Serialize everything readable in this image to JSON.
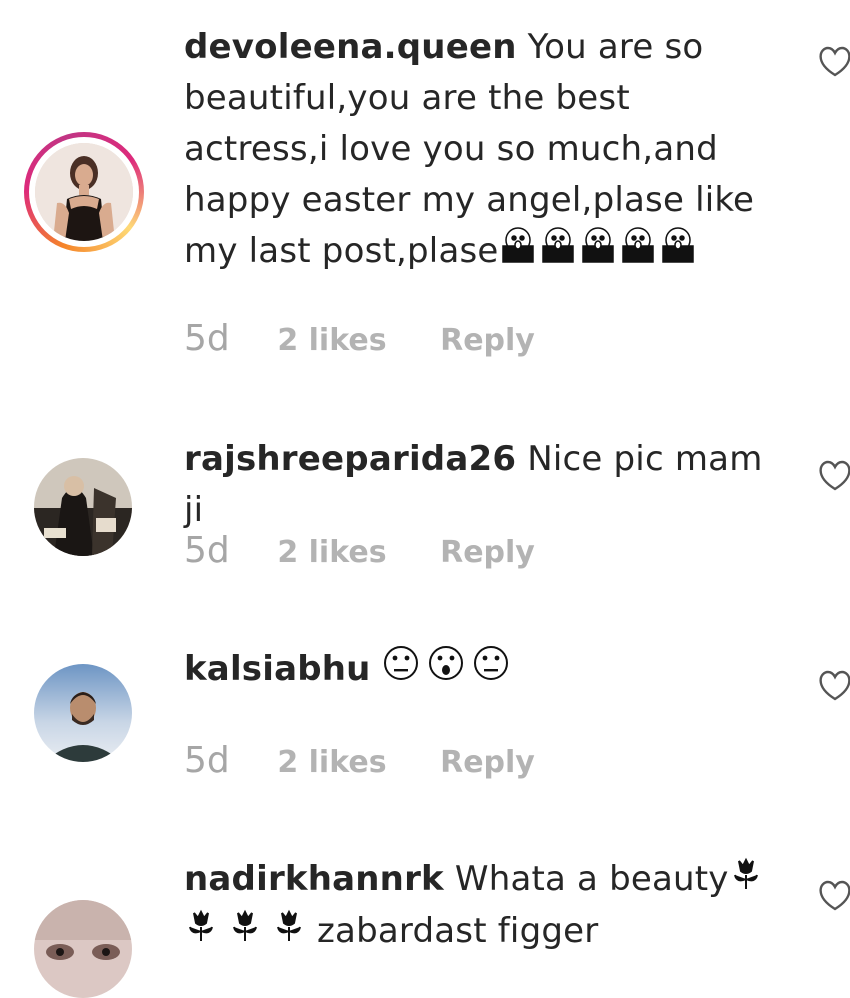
{
  "comments": [
    {
      "username": "devoleena.queen",
      "text": "You are so beautiful,you are the best actress,i love you so much,and happy easter my angel,plase like my last post,plase",
      "time": "5d",
      "likes": "2 likes",
      "reply": "Reply",
      "emoji": "face-screaming-in-fear x5",
      "has_story_ring": true
    },
    {
      "username": "rajshreeparida26",
      "text": "Nice pic mam ji",
      "time": "5d",
      "likes": "2 likes",
      "reply": "Reply"
    },
    {
      "username": "kalsiabhu",
      "text": "",
      "emoji": "face-with-rolling-eyes, face-with-open-mouth, face-with-rolling-eyes",
      "time": "5d",
      "likes": "2 likes",
      "reply": "Reply"
    },
    {
      "username": "nadirkhannrk",
      "text": "Whata a beauty",
      "text_after_emoji": "zabardast figger",
      "emoji": "tulip x4"
    }
  ],
  "colors": {
    "text": "#262626",
    "meta": "#b3b3b3",
    "story_ring": "#dd2a7b"
  }
}
